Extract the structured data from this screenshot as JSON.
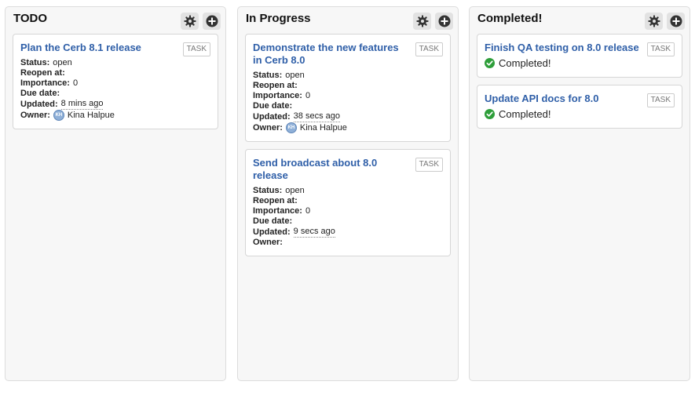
{
  "columns": [
    {
      "title": "TODO",
      "cards": [
        {
          "title": "Plan the Cerb 8.1 release",
          "badge": "TASK",
          "status_label": "Status:",
          "status": "open",
          "reopen_label": "Reopen at:",
          "importance_label": "Importance:",
          "importance": "0",
          "due_label": "Due date:",
          "updated_label": "Updated:",
          "updated": "8 mins ago",
          "owner_label": "Owner:",
          "owner": "Kina Halpue"
        }
      ]
    },
    {
      "title": "In Progress",
      "cards": [
        {
          "title": "Demonstrate the new features in Cerb 8.0",
          "badge": "TASK",
          "status_label": "Status:",
          "status": "open",
          "reopen_label": "Reopen at:",
          "importance_label": "Importance:",
          "importance": "0",
          "due_label": "Due date:",
          "updated_label": "Updated:",
          "updated": "38 secs ago",
          "owner_label": "Owner:",
          "owner": "Kina Halpue"
        },
        {
          "title": "Send broadcast about 8.0 release",
          "badge": "TASK",
          "status_label": "Status:",
          "status": "open",
          "reopen_label": "Reopen at:",
          "importance_label": "Importance:",
          "importance": "0",
          "due_label": "Due date:",
          "updated_label": "Updated:",
          "updated": "9 secs ago",
          "owner_label": "Owner:",
          "owner": ""
        }
      ]
    },
    {
      "title": "Completed!",
      "cards": [
        {
          "title": "Finish QA testing on 8.0 release",
          "badge": "TASK",
          "completed_text": "Completed!"
        },
        {
          "title": "Update API docs for 8.0",
          "badge": "TASK",
          "completed_text": "Completed!"
        }
      ]
    }
  ],
  "icons": {
    "settings": "gear-icon",
    "add": "plus-circle-icon",
    "completed": "check-circle-icon",
    "owner": "avatar-icon"
  },
  "colors": {
    "link": "#2f5fa8",
    "check": "#2e9e3a",
    "column_bg": "#f7f7f7"
  }
}
